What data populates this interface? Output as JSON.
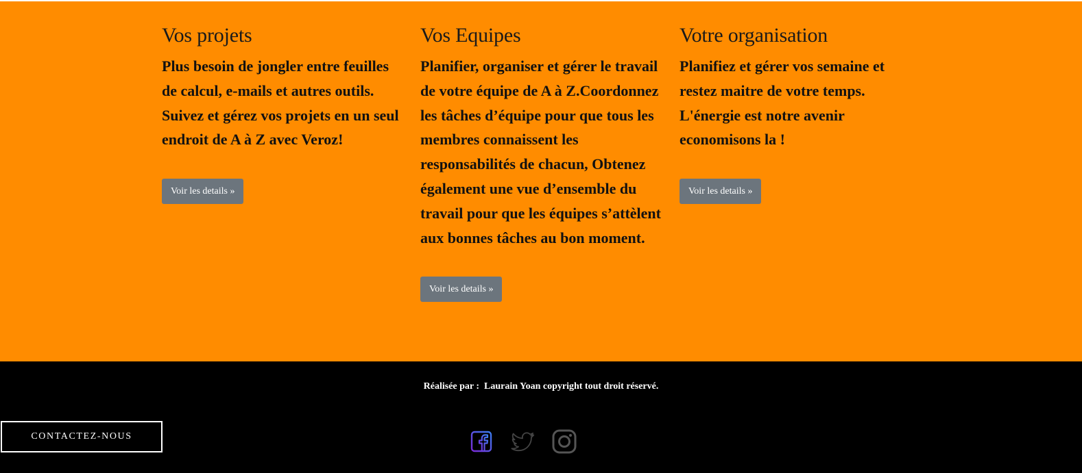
{
  "columns": [
    {
      "title": "Vos projets",
      "text": "Plus besoin de jongler entre feuilles de calcul, e-mails et autres outils. Suivez et gérez vos projets en un seul endroit de A à Z avec Veroz!",
      "button_label": "Voir les details »"
    },
    {
      "title": "Vos Equipes",
      "text": "Planifier, organiser et gérer le travail de votre équipe de A à Z.Coordonnez les tâches d’équipe pour que tous les membres connaissent les responsabilités de chacun, Obtenez également une vue d’ensemble du travail pour que les équipes s’attèlent aux bonnes tâches au bon moment.",
      "button_label": "Voir les details »"
    },
    {
      "title": "Votre organisation",
      "text": "Planifiez et gérer vos semaine et restez maitre de votre temps. L'énergie est notre avenir economisons la !",
      "button_label": "Voir les details »"
    }
  ],
  "footer": {
    "credit": "Réalisée par :  Laurain Yoan copyright tout droit réservé.",
    "contact_label": "CONTACTEZ-NOUS",
    "socials": [
      "facebook-icon",
      "twitter-icon",
      "instagram-icon"
    ]
  },
  "colors": {
    "section_bg": "#ff8c00",
    "footer_bg": "#000000",
    "button_bg": "#6c757d"
  }
}
